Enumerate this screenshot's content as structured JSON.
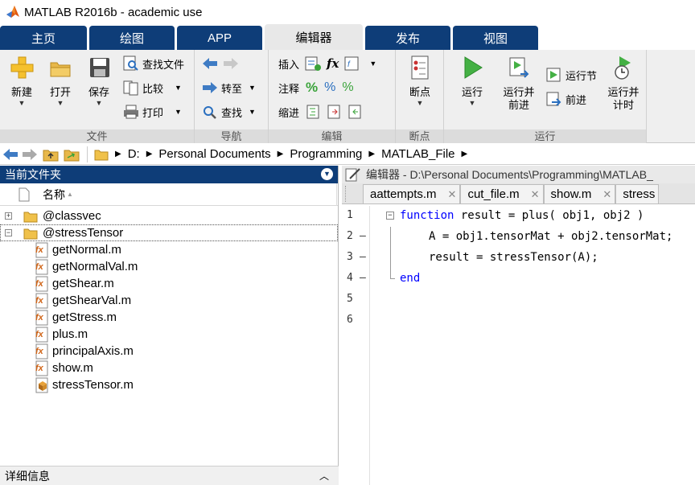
{
  "window": {
    "title": "MATLAB R2016b - academic use"
  },
  "tabs": [
    {
      "label": "主页"
    },
    {
      "label": "绘图"
    },
    {
      "label": "APP"
    },
    {
      "label": "编辑器"
    },
    {
      "label": "发布"
    },
    {
      "label": "视图"
    }
  ],
  "ribbon": {
    "file": {
      "group_label": "文件",
      "new_label": "新建",
      "open_label": "打开",
      "save_label": "保存",
      "find_files_label": "查找文件",
      "compare_label": "比较",
      "print_label": "打印"
    },
    "navigate": {
      "group_label": "导航",
      "goto_label": "转至",
      "find_label": "查找"
    },
    "edit": {
      "group_label": "编辑",
      "insert_label": "插入",
      "comment_label": "注释",
      "indent_label": "缩进",
      "fx_label": "fx"
    },
    "breakpoints": {
      "group_label": "断点",
      "breakpoints_label": "断点"
    },
    "run": {
      "group_label": "运行",
      "run_label": "运行",
      "run_advance_label_1": "运行并",
      "run_advance_label_2": "前进",
      "run_section_label": "运行节",
      "advance_label": "前进",
      "run_time_label_1": "运行并",
      "run_time_label_2": "计时"
    }
  },
  "address": {
    "crumbs": [
      "D:",
      "Personal Documents",
      "Programming",
      "MATLAB_File"
    ]
  },
  "current_folder": {
    "title": "当前文件夹",
    "column_name": "名称",
    "sort_indicator": "▲",
    "items": [
      {
        "name": "@classvec",
        "expander": "+"
      },
      {
        "name": "@stressTensor",
        "expander": "−"
      },
      {
        "name": "getNormal.m"
      },
      {
        "name": "getNormalVal.m"
      },
      {
        "name": "getShear.m"
      },
      {
        "name": "getShearVal.m"
      },
      {
        "name": "getStress.m"
      },
      {
        "name": "plus.m"
      },
      {
        "name": "principalAxis.m"
      },
      {
        "name": "show.m"
      },
      {
        "name": "stressTensor.m"
      }
    ],
    "details_label": "详细信息"
  },
  "editor": {
    "header": "编辑器 - D:\\Personal Documents\\Programming\\MATLAB_",
    "file_tabs": [
      {
        "name": "aattempts.m"
      },
      {
        "name": "cut_file.m"
      },
      {
        "name": "show.m"
      },
      {
        "name": "stress"
      }
    ],
    "lines": [
      {
        "num": "1",
        "kw": "function",
        "rest": " result = plus( obj1, obj2 )"
      },
      {
        "num": "2",
        "text": "A = obj1.tensorMat + obj2.tensorMat;"
      },
      {
        "num": "3",
        "text": "result = stressTensor(A);"
      },
      {
        "num": "4",
        "kw": "end",
        "rest": ""
      },
      {
        "num": "5"
      },
      {
        "num": "6"
      }
    ]
  },
  "colors": {
    "tab_blue": "#0e3d78",
    "keyword_blue": "#0000ff"
  }
}
